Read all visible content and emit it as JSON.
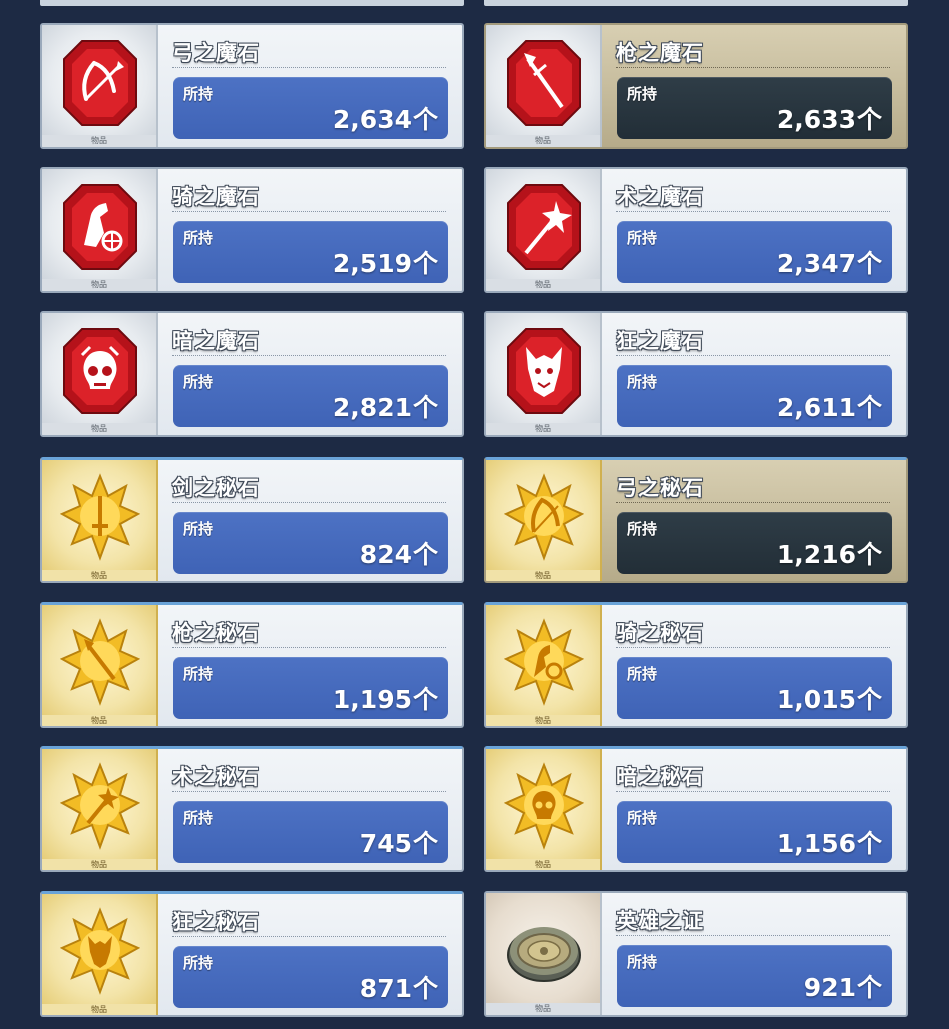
{
  "labels": {
    "held": "所持",
    "unit": "个",
    "thumb_caption": "物品"
  },
  "items": [
    {
      "name": "弓之魔石",
      "count": "2,634",
      "icon": "bow-magic-gem-icon"
    },
    {
      "name": "枪之魔石",
      "count": "2,633",
      "icon": "lance-magic-gem-icon",
      "selected": true
    },
    {
      "name": "骑之魔石",
      "count": "2,519",
      "icon": "knight-magic-gem-icon"
    },
    {
      "name": "术之魔石",
      "count": "2,347",
      "icon": "caster-magic-gem-icon"
    },
    {
      "name": "暗之魔石",
      "count": "2,821",
      "icon": "assassin-magic-gem-icon"
    },
    {
      "name": "狂之魔石",
      "count": "2,611",
      "icon": "berserker-magic-gem-icon"
    },
    {
      "name": "剑之秘石",
      "count": "824",
      "icon": "saber-secret-gem-icon"
    },
    {
      "name": "弓之秘石",
      "count": "1,216",
      "icon": "archer-secret-gem-icon",
      "selected": true
    },
    {
      "name": "枪之秘石",
      "count": "1,195",
      "icon": "lancer-secret-gem-icon"
    },
    {
      "name": "骑之秘石",
      "count": "1,015",
      "icon": "rider-secret-gem-icon"
    },
    {
      "name": "术之秘石",
      "count": "745",
      "icon": "caster-secret-gem-icon"
    },
    {
      "name": "暗之秘石",
      "count": "1,156",
      "icon": "assassin-secret-gem-icon"
    },
    {
      "name": "狂之秘石",
      "count": "871",
      "icon": "berserker-secret-gem-icon"
    },
    {
      "name": "英雄之证",
      "count": "921",
      "icon": "hero-proof-coin-icon"
    }
  ],
  "colors": {
    "background": "#1d2a44",
    "count_box": "#4567ba",
    "count_box_selected": "#28343f",
    "selected_card": "#c7bea0",
    "red_gem": "#d51e24",
    "gold_gem": "#f2bc25"
  }
}
